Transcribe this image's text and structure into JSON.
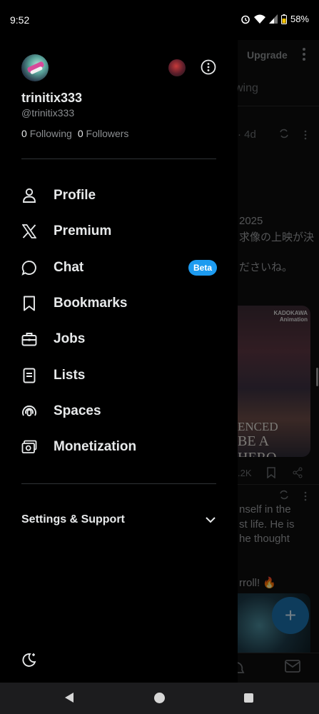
{
  "status_bar": {
    "time": "9:52",
    "battery": "58%",
    "icons": [
      "alarm-icon",
      "wifi-icon",
      "signal-icon",
      "battery-icon"
    ]
  },
  "drawer": {
    "profile": {
      "display_name": "trinitix333",
      "handle": "@trinitix333",
      "following_count": "0",
      "following_label": "Following",
      "followers_count": "0",
      "followers_label": "Followers"
    },
    "nav_items": [
      {
        "label": "Profile",
        "icon": "person-icon"
      },
      {
        "label": "Premium",
        "icon": "x-logo-icon"
      },
      {
        "label": "Chat",
        "icon": "chat-bubble-icon",
        "badge": "Beta"
      },
      {
        "label": "Bookmarks",
        "icon": "bookmark-icon"
      },
      {
        "label": "Jobs",
        "icon": "briefcase-icon"
      },
      {
        "label": "Lists",
        "icon": "list-icon"
      },
      {
        "label": "Spaces",
        "icon": "spaces-icon"
      },
      {
        "label": "Monetization",
        "icon": "monetization-icon"
      }
    ],
    "settings_label": "Settings & Support"
  },
  "feed": {
    "upgrade": "Upgrade",
    "tab": "wing",
    "meta": "· 4d",
    "jp_line1": "2025",
    "jp_line2": "求像の上映が決",
    "jp_line3": "ださいね。",
    "poster_brand_line1": "KADOKAWA",
    "poster_brand_line2": "Animation",
    "poster_title_line1": "ENCED",
    "poster_title_line2": "BE A HERO",
    "likes": ".2K",
    "text_line1": "nself in the",
    "text_line2": "st life. He is",
    "text_line3": "he thought",
    "text_line4": "rroll! 🔥"
  },
  "colors": {
    "accent": "#1d9bf0",
    "background": "#000000",
    "muted_text": "#8b8e91"
  }
}
